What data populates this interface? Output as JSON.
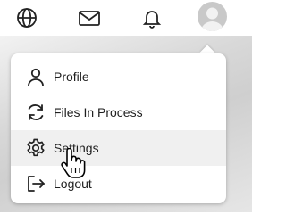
{
  "header": {
    "icons": [
      "globe-icon",
      "mail-icon",
      "bell-icon"
    ],
    "avatar": "avatar"
  },
  "menu": {
    "items": [
      {
        "label": "Profile",
        "icon": "user-icon"
      },
      {
        "label": "Files In Process",
        "icon": "refresh-icon"
      },
      {
        "label": "Settings",
        "icon": "gear-icon",
        "active": true
      },
      {
        "label": "Logout",
        "icon": "logout-icon"
      }
    ]
  },
  "colors": {
    "menu_bg": "#ffffff",
    "active_bg": "#f0f0f0",
    "text": "#1f1f1f"
  }
}
